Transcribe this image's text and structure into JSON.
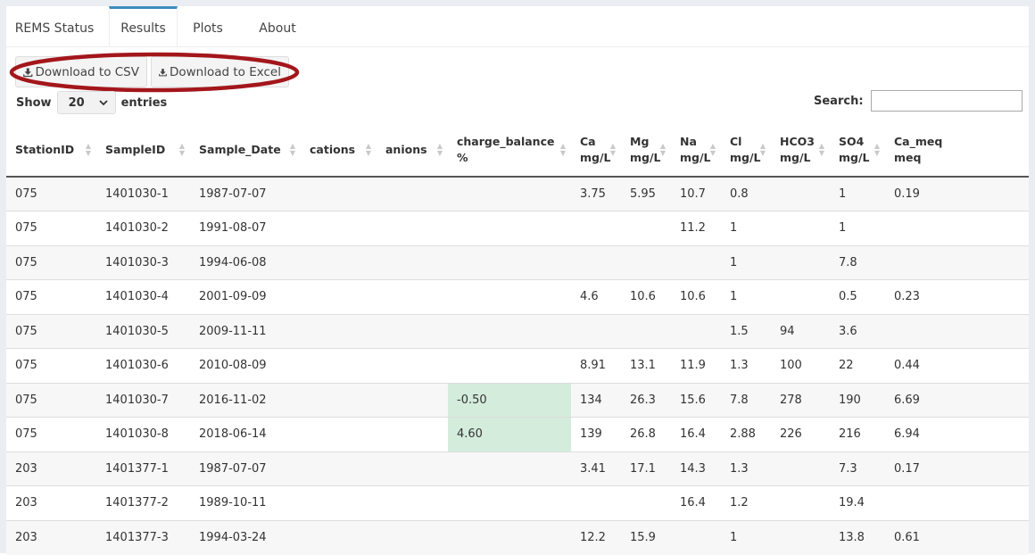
{
  "tabs": [
    {
      "label": "REMS Status"
    },
    {
      "label": "Results"
    },
    {
      "label": "Plots"
    },
    {
      "label": "About"
    }
  ],
  "buttons": {
    "csv_label": "Download to CSV",
    "excel_label": "Download to Excel"
  },
  "length": {
    "show_label": "Show",
    "selected": "20",
    "entries_label": "entries"
  },
  "search": {
    "label": "Search:",
    "value": ""
  },
  "colors": {
    "accent": "#3c8dbc",
    "highlight_ellipse": "#a3161b",
    "charge_balance_ok": "#d4ecdc"
  },
  "table": {
    "columns": [
      {
        "label": "StationID",
        "unit": ""
      },
      {
        "label": "SampleID",
        "unit": ""
      },
      {
        "label": "Sample_Date",
        "unit": ""
      },
      {
        "label": "cations",
        "unit": ""
      },
      {
        "label": "anions",
        "unit": ""
      },
      {
        "label": "charge_balance",
        "unit": "%"
      },
      {
        "label": "Ca",
        "unit": "mg/L"
      },
      {
        "label": "Mg",
        "unit": "mg/L"
      },
      {
        "label": "Na",
        "unit": "mg/L"
      },
      {
        "label": "Cl",
        "unit": "mg/L"
      },
      {
        "label": "HCO3",
        "unit": "mg/L"
      },
      {
        "label": "SO4",
        "unit": "mg/L"
      },
      {
        "label": "Ca_meq",
        "unit": "meq"
      }
    ],
    "rows": [
      [
        "075",
        "1401030-1",
        "1987-07-07",
        "",
        "",
        "",
        "3.75",
        "5.95",
        "10.7",
        "0.8",
        "",
        "1",
        "0.19"
      ],
      [
        "075",
        "1401030-2",
        "1991-08-07",
        "",
        "",
        "",
        "",
        "",
        "11.2",
        "1",
        "",
        "1",
        ""
      ],
      [
        "075",
        "1401030-3",
        "1994-06-08",
        "",
        "",
        "",
        "",
        "",
        "",
        "1",
        "",
        "7.8",
        ""
      ],
      [
        "075",
        "1401030-4",
        "2001-09-09",
        "",
        "",
        "",
        "4.6",
        "10.6",
        "10.6",
        "1",
        "",
        "0.5",
        "0.23"
      ],
      [
        "075",
        "1401030-5",
        "2009-11-11",
        "",
        "",
        "",
        "",
        "",
        "",
        "1.5",
        "94",
        "3.6",
        ""
      ],
      [
        "075",
        "1401030-6",
        "2010-08-09",
        "",
        "",
        "",
        "8.91",
        "13.1",
        "11.9",
        "1.3",
        "100",
        "22",
        "0.44"
      ],
      [
        "075",
        "1401030-7",
        "2016-11-02",
        "",
        "",
        "-0.50",
        "134",
        "26.3",
        "15.6",
        "7.8",
        "278",
        "190",
        "6.69"
      ],
      [
        "075",
        "1401030-8",
        "2018-06-14",
        "",
        "",
        "4.60",
        "139",
        "26.8",
        "16.4",
        "2.88",
        "226",
        "216",
        "6.94"
      ],
      [
        "203",
        "1401377-1",
        "1987-07-07",
        "",
        "",
        "",
        "3.41",
        "17.1",
        "14.3",
        "1.3",
        "",
        "7.3",
        "0.17"
      ],
      [
        "203",
        "1401377-2",
        "1989-10-11",
        "",
        "",
        "",
        "",
        "",
        "16.4",
        "1.2",
        "",
        "19.4",
        ""
      ],
      [
        "203",
        "1401377-3",
        "1994-03-24",
        "",
        "",
        "",
        "12.2",
        "15.9",
        "",
        "1",
        "",
        "13.8",
        "0.61"
      ]
    ]
  }
}
